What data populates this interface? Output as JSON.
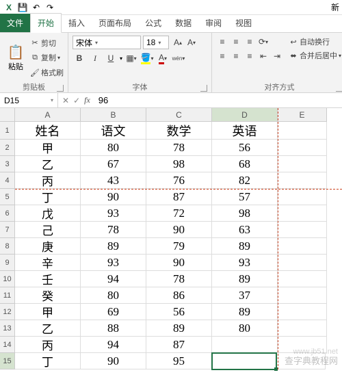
{
  "qat": {
    "save": "💾",
    "undo": "↶",
    "redo": "↷"
  },
  "title_partial": "新",
  "tabs": {
    "file": "文件",
    "home": "开始",
    "insert": "插入",
    "layout": "页面布局",
    "formulas": "公式",
    "data": "数据",
    "review": "审阅",
    "view": "视图"
  },
  "ribbon": {
    "clipboard": {
      "paste": "粘贴",
      "cut": "剪切",
      "copy": "复制",
      "painter": "格式刷",
      "label": "剪贴板"
    },
    "font": {
      "name": "宋体",
      "size": "18",
      "label": "字体",
      "bold": "B",
      "italic": "I",
      "underline": "U"
    },
    "align": {
      "wrap": "自动换行",
      "merge": "合并后居中",
      "label": "对齐方式"
    }
  },
  "namebox": "D15",
  "formula": "96",
  "cols": [
    "A",
    "B",
    "C",
    "D",
    "E"
  ],
  "chart_data": {
    "type": "table",
    "headers": [
      "姓名",
      "语文",
      "数学",
      "英语"
    ],
    "rows": [
      [
        "甲",
        "80",
        "78",
        "56"
      ],
      [
        "乙",
        "67",
        "98",
        "68"
      ],
      [
        "丙",
        "43",
        "76",
        "82"
      ],
      [
        "丁",
        "90",
        "87",
        "57"
      ],
      [
        "戊",
        "93",
        "72",
        "98"
      ],
      [
        "己",
        "78",
        "90",
        "63"
      ],
      [
        "庚",
        "89",
        "79",
        "89"
      ],
      [
        "辛",
        "93",
        "90",
        "93"
      ],
      [
        "壬",
        "94",
        "78",
        "89"
      ],
      [
        "癸",
        "80",
        "86",
        "37"
      ],
      [
        "甲",
        "69",
        "56",
        "89"
      ],
      [
        "乙",
        "88",
        "89",
        "80"
      ],
      [
        "丙",
        "94",
        "87",
        ""
      ],
      [
        "丁",
        "90",
        "95",
        ""
      ]
    ]
  },
  "active_cell": {
    "row": 15,
    "col": "D"
  },
  "watermark": "查字典教程网",
  "watermark_url": "www.jb51.net"
}
